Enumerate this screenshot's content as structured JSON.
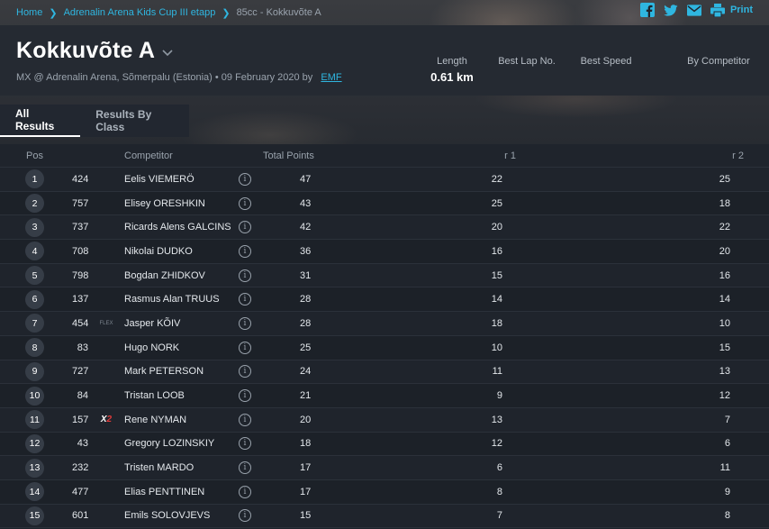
{
  "breadcrumb": {
    "items": [
      "Home",
      "Adrenalin Arena Kids Cup III etapp",
      "85cc - Kokkuvõte A"
    ]
  },
  "share": {
    "icons": [
      "facebook-icon",
      "twitter-icon",
      "email-icon",
      "print-icon"
    ],
    "print_label": "Print",
    "accent": "#2fb6e0"
  },
  "header": {
    "title": "Kokkuvõte A",
    "subtitle": "MX @ Adrenalin Arena, Sõmerpalu (Estonia) • 09 February 2020 by",
    "organizer": "EMF",
    "stats": {
      "length_label": "Length",
      "length_value": "0.61 km",
      "best_lap_label": "Best Lap No.",
      "best_speed_label": "Best Speed",
      "by_competitor_label": "By Competitor"
    }
  },
  "tabs": [
    {
      "label": "All Results",
      "active": true
    },
    {
      "label": "Results By Class",
      "active": false
    }
  ],
  "table": {
    "headers": {
      "pos": "Pos",
      "competitor": "Competitor",
      "total_points": "Total Points",
      "r1": "r 1",
      "r2": "r 2"
    },
    "rows": [
      {
        "pos": "1",
        "num": "424",
        "mark": "",
        "name": "Eelis VIEMERÖ",
        "points": "47",
        "r1": "22",
        "r2": "25"
      },
      {
        "pos": "2",
        "num": "757",
        "mark": "",
        "name": "Elisey ORESHKIN",
        "points": "43",
        "r1": "25",
        "r2": "18"
      },
      {
        "pos": "3",
        "num": "737",
        "mark": "",
        "name": "Ricards Alens GALCINS",
        "points": "42",
        "r1": "20",
        "r2": "22"
      },
      {
        "pos": "4",
        "num": "708",
        "mark": "",
        "name": "Nikolai DUDKO",
        "points": "36",
        "r1": "16",
        "r2": "20"
      },
      {
        "pos": "5",
        "num": "798",
        "mark": "",
        "name": "Bogdan ZHIDKOV",
        "points": "31",
        "r1": "15",
        "r2": "16"
      },
      {
        "pos": "6",
        "num": "137",
        "mark": "",
        "name": "Rasmus Alan TRUUS",
        "points": "28",
        "r1": "14",
        "r2": "14"
      },
      {
        "pos": "7",
        "num": "454",
        "mark": "FLEX",
        "name": "Jasper KÕIV",
        "points": "28",
        "r1": "18",
        "r2": "10"
      },
      {
        "pos": "8",
        "num": "83",
        "mark": "",
        "name": "Hugo NORK",
        "points": "25",
        "r1": "10",
        "r2": "15"
      },
      {
        "pos": "9",
        "num": "727",
        "mark": "",
        "name": "Mark PETERSON",
        "points": "24",
        "r1": "11",
        "r2": "13"
      },
      {
        "pos": "10",
        "num": "84",
        "mark": "",
        "name": "Tristan LOOB",
        "points": "21",
        "r1": "9",
        "r2": "12"
      },
      {
        "pos": "11",
        "num": "157",
        "mark": "X2",
        "name": "Rene NYMAN",
        "points": "20",
        "r1": "13",
        "r2": "7"
      },
      {
        "pos": "12",
        "num": "43",
        "mark": "",
        "name": "Gregory LOZINSKIY",
        "points": "18",
        "r1": "12",
        "r2": "6"
      },
      {
        "pos": "13",
        "num": "232",
        "mark": "",
        "name": "Tristen MARDO",
        "points": "17",
        "r1": "6",
        "r2": "11"
      },
      {
        "pos": "14",
        "num": "477",
        "mark": "",
        "name": "Elias PENTTINEN",
        "points": "17",
        "r1": "8",
        "r2": "9"
      },
      {
        "pos": "15",
        "num": "601",
        "mark": "",
        "name": "Emils SOLOVJEVS",
        "points": "15",
        "r1": "7",
        "r2": "8"
      }
    ]
  }
}
